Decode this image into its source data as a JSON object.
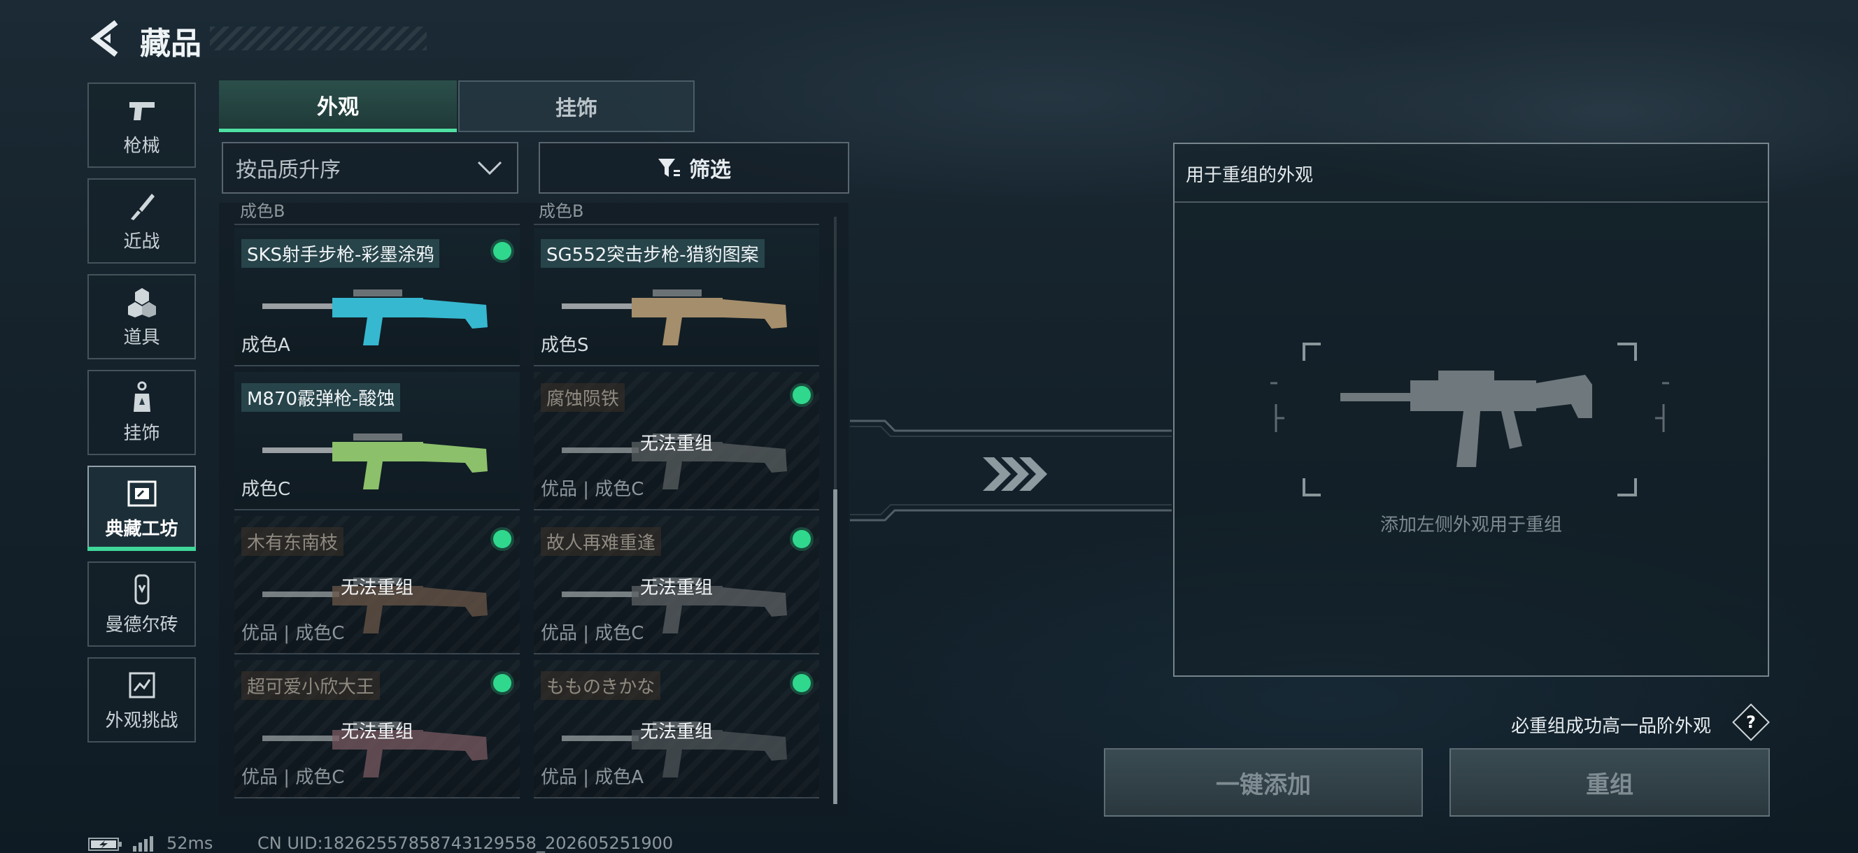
{
  "header": {
    "title": "藏品"
  },
  "sidebar": {
    "items": [
      {
        "label": "枪械",
        "icon": "pistol-icon"
      },
      {
        "label": "近战",
        "icon": "knife-icon"
      },
      {
        "label": "道具",
        "icon": "grenade-icon"
      },
      {
        "label": "挂饰",
        "icon": "charm-icon"
      },
      {
        "label": "典藏工坊",
        "icon": "workshop-icon",
        "active": true
      },
      {
        "label": "曼德尔砖",
        "icon": "brick-icon"
      },
      {
        "label": "外观挑战",
        "icon": "challenge-icon"
      }
    ]
  },
  "tabs": [
    {
      "label": "外观",
      "active": true
    },
    {
      "label": "挂饰",
      "active": false
    }
  ],
  "sort": {
    "selected": "按品质升序"
  },
  "filter": {
    "label": "筛选"
  },
  "list": {
    "partial_top": [
      "成色B",
      "成色B"
    ],
    "items": [
      {
        "name": "SKS射手步枪-彩墨涂鸦",
        "grade": "成色A",
        "selected": true,
        "status": "",
        "gun_color": "#36b8d0"
      },
      {
        "name": "SG552突击步枪-猎豹图案",
        "grade": "成色S",
        "selected": false,
        "status": "",
        "gun_color": "#a58e6b"
      },
      {
        "name": "M870霰弹枪-酸蚀",
        "grade": "成色C",
        "selected": false,
        "status": "",
        "gun_color": "#8cc06a"
      },
      {
        "name": "腐蚀陨铁",
        "grade": "优品 | 成色C",
        "selected": true,
        "status": "无法重组",
        "gun_color": "#5a5f60"
      },
      {
        "name": "木有东南枝",
        "grade": "优品 | 成色C",
        "selected": true,
        "status": "无法重组",
        "gun_color": "#6a5648"
      },
      {
        "name": "故人再难重逢",
        "grade": "优品 | 成色C",
        "selected": true,
        "status": "无法重组",
        "gun_color": "#5c6064"
      },
      {
        "name": "超可爱小欣大王",
        "grade": "优品 | 成色C",
        "selected": true,
        "status": "无法重组",
        "gun_color": "#7a5a62"
      },
      {
        "name": "もものきかな",
        "grade": "优品 | 成色A",
        "selected": true,
        "status": "无法重组",
        "gun_color": "#4e5458"
      }
    ]
  },
  "recombine": {
    "header": "用于重组的外观",
    "hint": "添加左侧外观用于重组",
    "note": "必重组成功高一品阶外观",
    "help": "?",
    "add_all": "一键添加",
    "recombine": "重组"
  },
  "footer": {
    "ping": "52ms",
    "uid": "CN UID:18262557858743129558_202605251900"
  },
  "colors": {
    "accent": "#3fd79a",
    "panel_border": "#b9c6cd"
  }
}
